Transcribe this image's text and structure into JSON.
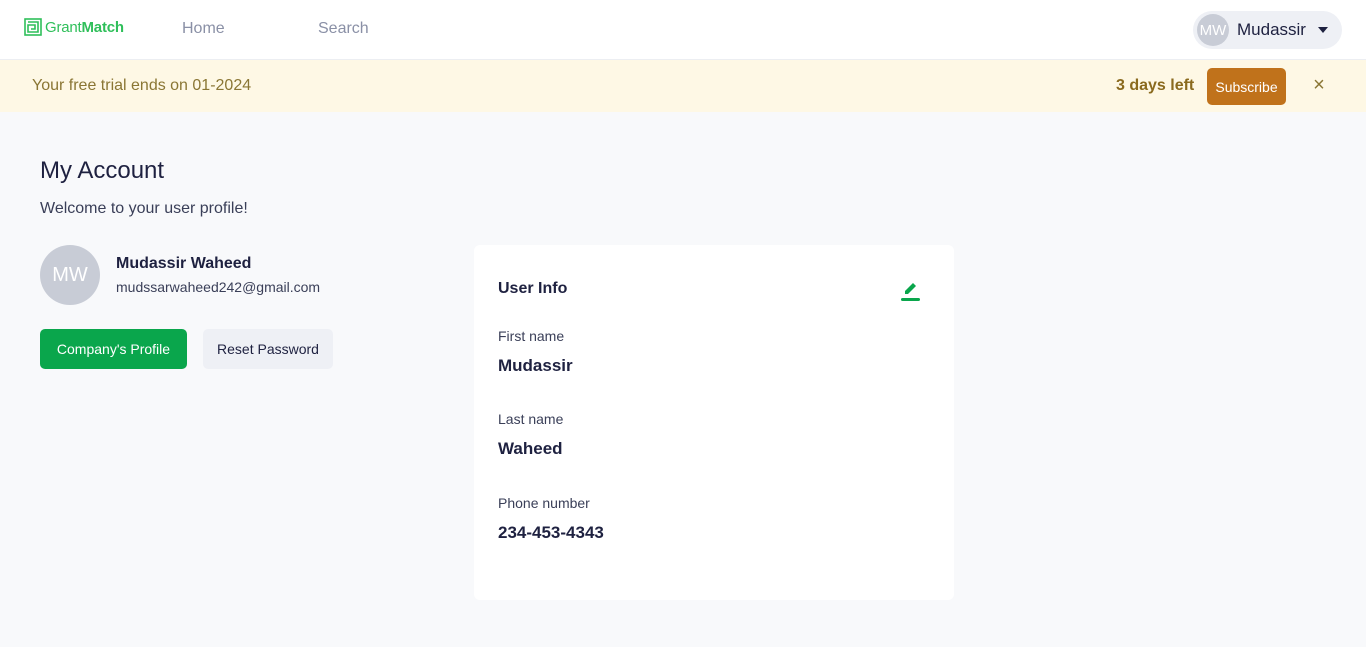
{
  "app": {
    "logo_text_light": "Grant",
    "logo_text_bold": "Match"
  },
  "nav": {
    "home": "Home",
    "search": "Search"
  },
  "user_menu": {
    "initials": "MW",
    "name": "Mudassir"
  },
  "banner": {
    "text": "Your free trial ends on 01-2024",
    "days_left": "3 days left",
    "subscribe": "Subscribe",
    "close": "×"
  },
  "account": {
    "title": "My Account",
    "subtitle": "Welcome to your user profile!",
    "initials": "MW",
    "full_name": "Mudassir Waheed",
    "email": "mudssarwaheed242@gmail.com",
    "company_profile_button": "Company's Profile",
    "reset_password_button": "Reset Password"
  },
  "user_info": {
    "title": "User Info",
    "fields": [
      {
        "label": "First name",
        "value": "Mudassir"
      },
      {
        "label": "Last name",
        "value": "Waheed"
      },
      {
        "label": "Phone number",
        "value": "234-453-4343"
      }
    ]
  },
  "colors": {
    "brand_green": "#0aa64c",
    "logo_green": "#2fbf5a",
    "banner_bg": "#fef8e5",
    "subscribe_bg": "#c0721b",
    "text_dark": "#1e2140"
  },
  "icons": {
    "logo": "maze-logo-icon",
    "caret": "chevron-down-icon",
    "close": "close-icon",
    "edit": "pencil-icon"
  }
}
